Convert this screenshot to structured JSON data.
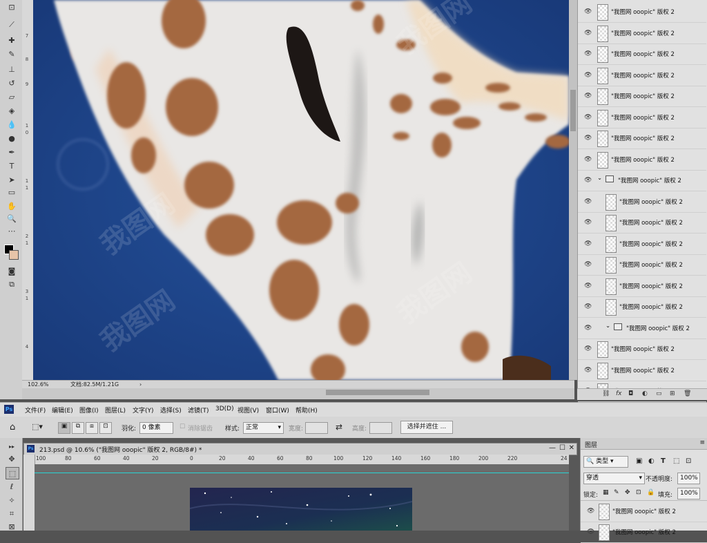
{
  "top_window": {
    "zoom": "102.6%",
    "doc_size": "文档:82.5M/1.21G",
    "ruler_marks": [
      "7",
      "8",
      "9",
      "1",
      "0",
      "1",
      "1",
      "2",
      "1",
      "3",
      "1",
      "4"
    ],
    "layers": [
      {
        "name": "\"我图网 ooopic\" 版权 2",
        "indent": 0
      },
      {
        "name": "\"我图网 ooopic\" 版权 2",
        "indent": 0
      },
      {
        "name": "\"我图网 ooopic\" 版权 2",
        "indent": 0
      },
      {
        "name": "\"我图网 ooopic\" 版权 2",
        "indent": 0
      },
      {
        "name": "\"我图网 ooopic\" 版权 2",
        "indent": 0
      },
      {
        "name": "\"我图网 ooopic\" 版权 2",
        "indent": 0
      },
      {
        "name": "\"我图网 ooopic\" 版权 2",
        "indent": 0
      },
      {
        "name": "\"我图网 ooopic\" 版权 2",
        "indent": 0
      },
      {
        "name": "\"我图网 ooopic\" 版权 2",
        "indent": 0,
        "folder": true
      },
      {
        "name": "\"我图网 ooopic\" 版权 2",
        "indent": 1
      },
      {
        "name": "\"我图网 ooopic\" 版权 2",
        "indent": 1
      },
      {
        "name": "\"我图网 ooopic\" 版权 2",
        "indent": 1
      },
      {
        "name": "\"我图网 ooopic\" 版权 2",
        "indent": 1
      },
      {
        "name": "\"我图网 ooopic\" 版权 2",
        "indent": 1
      },
      {
        "name": "\"我图网 ooopic\" 版权 2",
        "indent": 1
      },
      {
        "name": "\"我图网 ooopic\" 版权 2",
        "indent": 1,
        "folder": true
      },
      {
        "name": "\"我图网 ooopic\" 版权 2",
        "indent": 0
      },
      {
        "name": "\"我图网 ooopic\" 版权 2",
        "indent": 0
      },
      {
        "name": "\"我图网 ooopic\" 拷贝 2",
        "indent": 0
      }
    ],
    "footer_icons": [
      "link-icon",
      "fx",
      "mask-icon",
      "adjustment-icon",
      "folder-icon",
      "new-layer-icon",
      "trash-icon"
    ]
  },
  "menubar": {
    "app_badge": "Ps",
    "items": [
      "文件(F)",
      "编辑(E)",
      "图像(I)",
      "图层(L)",
      "文字(Y)",
      "选择(S)",
      "滤镜(T)",
      "3D(D)",
      "视图(V)",
      "窗口(W)",
      "帮助(H)"
    ]
  },
  "options": {
    "feather_label": "羽化:",
    "feather_value": "0 像素",
    "antialias_label": "消除锯齿",
    "style_label": "样式:",
    "style_value": "正常",
    "width_label": "宽度:",
    "height_label": "高度:",
    "select_mask_button": "选择并遮住 ..."
  },
  "document": {
    "tab_title": "213.psd @ 10.6% (\"我图网 ooopic\" 版权 2, RGB/8#) *",
    "ruler_marks": [
      "100",
      "80",
      "60",
      "40",
      "20",
      "0",
      "20",
      "40",
      "60",
      "80",
      "100",
      "120",
      "140",
      "160",
      "180",
      "200",
      "220",
      "24"
    ]
  },
  "layers_panel": {
    "title": "图层",
    "kind_label": "类型",
    "blend_mode": "穿透",
    "opacity_label": "不透明度:",
    "opacity_value": "100%",
    "lock_label": "锁定:",
    "fill_label": "填充:",
    "fill_value": "100%",
    "rows": [
      "\"我图网 ooopic\" 版权 2",
      "\"我图网 ooopic\" 版权 2"
    ]
  },
  "watermark": "我图网",
  "colors": {
    "canvas_blue": "#1d3f80",
    "ui_gray": "#d6d6d6",
    "guide": "#28d4d4"
  }
}
